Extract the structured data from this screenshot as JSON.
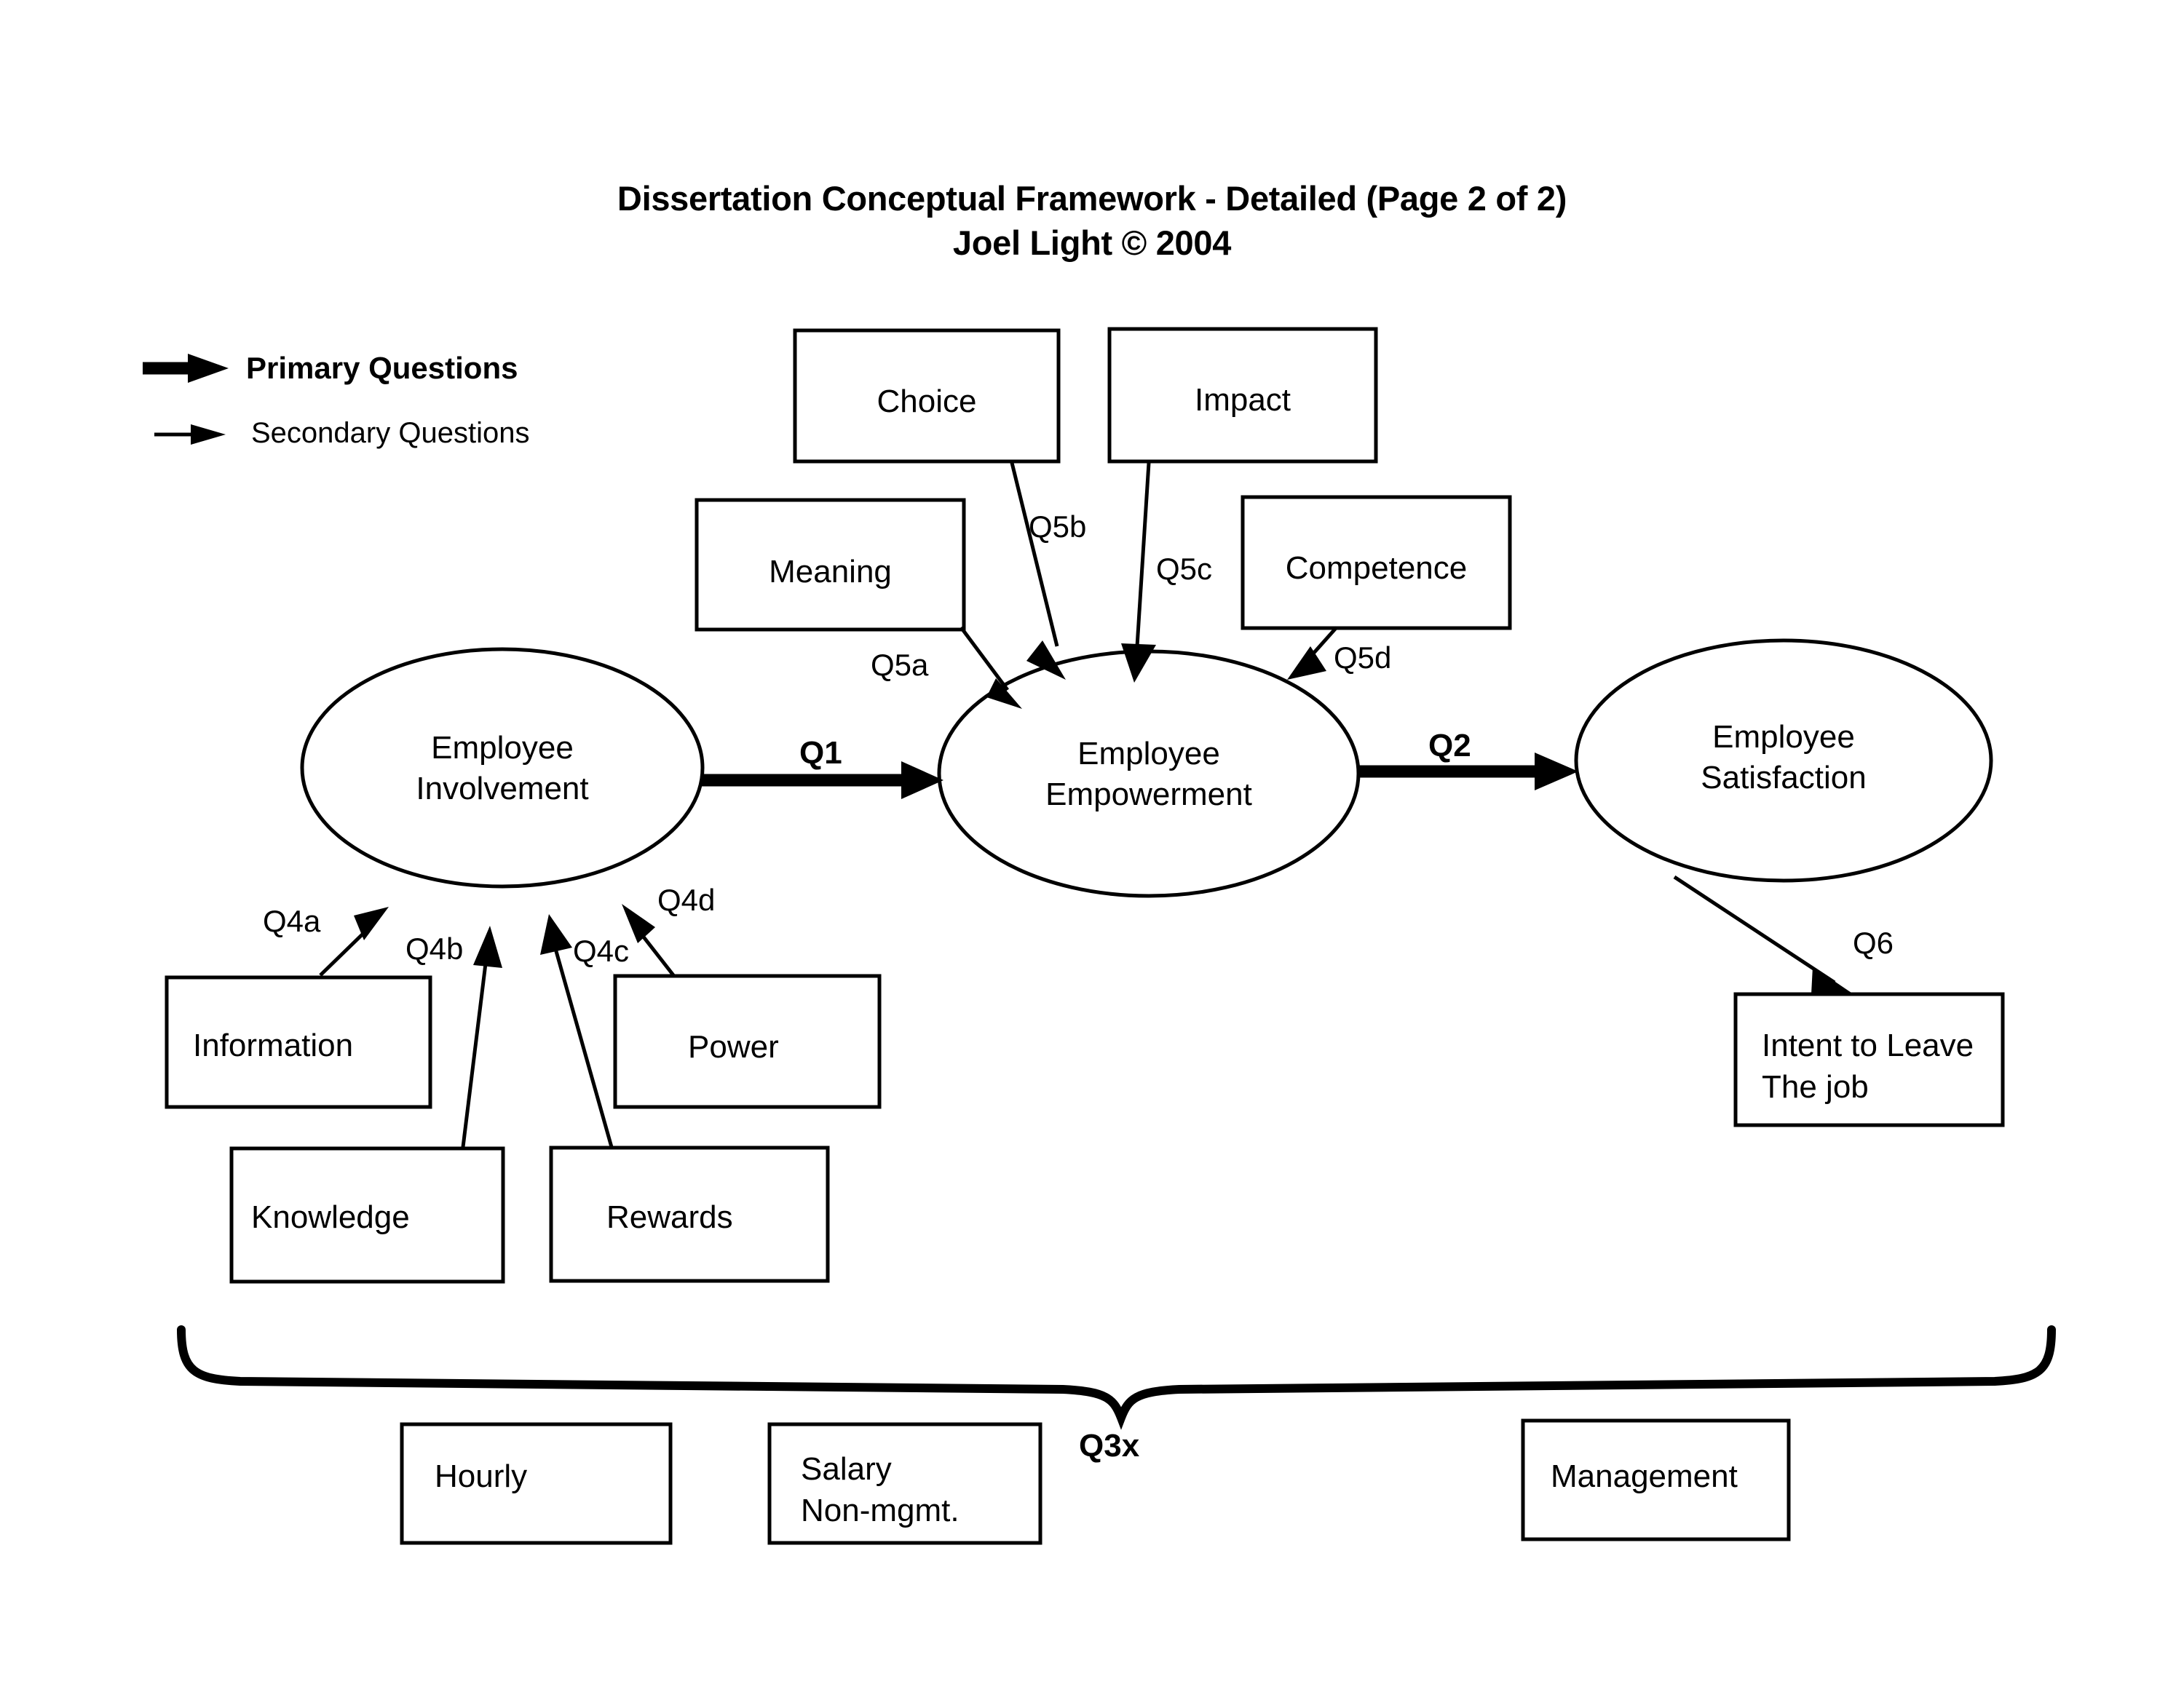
{
  "title": {
    "line1": "Dissertation Conceptual Framework - Detailed (Page 2 of 2)",
    "line2": "Joel Light © 2004"
  },
  "legend": {
    "primary": "Primary Questions",
    "secondary": "Secondary Questions"
  },
  "nodes": {
    "involvement": "Employee\nInvolvement",
    "empowerment": "Employee\nEmpowerment",
    "satisfaction": "Employee\nSatisfaction"
  },
  "boxes": {
    "choice": "Choice",
    "impact": "Impact",
    "meaning": "Meaning",
    "competence": "Competence",
    "information": "Information",
    "knowledge": "Knowledge",
    "rewards": "Rewards",
    "power": "Power",
    "intent_to_leave": "Intent to Leave\nThe job",
    "hourly": "Hourly",
    "salary": "Salary\nNon-mgmt.",
    "management": "Management"
  },
  "edges": {
    "q1": "Q1",
    "q2": "Q2",
    "q3x": "Q3x",
    "q4a": "Q4a",
    "q4b": "Q4b",
    "q4c": "Q4c",
    "q4d": "Q4d",
    "q5a": "Q5a",
    "q5b": "Q5b",
    "q5c": "Q5c",
    "q5d": "Q5d",
    "q6": "Q6"
  },
  "colors": {
    "stroke": "#000000",
    "fill": "#ffffff",
    "background": "#ffffff"
  }
}
